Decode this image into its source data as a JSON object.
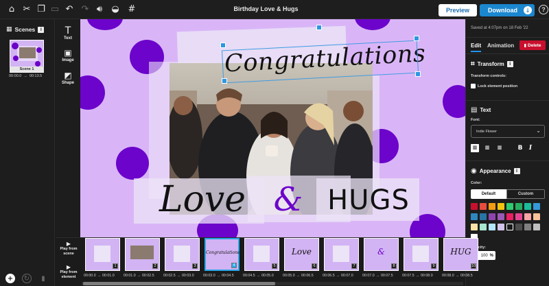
{
  "app": {
    "title": "Birthday Love & Hugs"
  },
  "toolbar": {
    "icons": [
      "home-icon",
      "scissors-icon",
      "copy-icon",
      "paste-icon",
      "undo-icon",
      "redo-icon",
      "volume-icon",
      "hide-icon",
      "grid-icon"
    ],
    "preview_label": "Preview",
    "download_label": "Download",
    "help_label": "?"
  },
  "scenes": {
    "header": "Scenes",
    "items": [
      {
        "label": "Scene 1",
        "start": "00:00.0",
        "arrow": "→",
        "end": "00:13.5"
      }
    ]
  },
  "tools": [
    {
      "label": "Text",
      "icon": "text-tool-icon"
    },
    {
      "label": "Image",
      "icon": "image-tool-icon"
    },
    {
      "label": "Shape",
      "icon": "shape-tool-icon"
    }
  ],
  "canvas": {
    "title_text": "Congratulations",
    "love_text": "Love",
    "amp_text": "&",
    "hugs_text": "HUGS",
    "background": "#d9b5f7",
    "accent": "#6c04cb"
  },
  "properties": {
    "saved_at": "Saved at 4:07pm on 18 Feb '22",
    "tabs": {
      "edit": "Edit",
      "animation": "Animation"
    },
    "delete_label": "Delete",
    "transform": {
      "title": "Transform",
      "controls_label": "Transform controls:",
      "lock_label": "Lock element position"
    },
    "text": {
      "title": "Text",
      "font_label": "Font:",
      "font_value": "Indie Flower",
      "bold": "B",
      "italic": "I"
    },
    "appearance": {
      "title": "Appearance",
      "color_label": "Color:",
      "tab_default": "Default",
      "tab_custom": "Custom",
      "opacity_label": "Opacity:",
      "opacity_value": "100",
      "opacity_unit": "%",
      "swatches": [
        "#c8102e",
        "#e74c3c",
        "#f39c12",
        "#f1c40f",
        "#2ecc71",
        "#27ae60",
        "#1abc9c",
        "#3498db",
        "#2e86c1",
        "#2874a6",
        "#8e44ad",
        "#9b59b6",
        "#e91e63",
        "#e84393",
        "#f8a5a5",
        "#fbc39b",
        "#fde3a7",
        "#a8e6cf",
        "#b3e5fc",
        "#d1c4e9",
        "#1a1a1a",
        "#4d4d4d",
        "#808080",
        "#bfbfbf",
        "#ffffff"
      ]
    }
  },
  "timeline": {
    "play_scene": "Play from scene",
    "play_element": "Play from element",
    "frames": [
      {
        "num": "1",
        "cap": "",
        "start": "00:00.0",
        "end": "00:01.0"
      },
      {
        "num": "2",
        "cap": "",
        "start": "00:01.0",
        "end": "00:02.5"
      },
      {
        "num": "3",
        "cap": "",
        "start": "00:02.5",
        "end": "00:03.0"
      },
      {
        "num": "4",
        "cap": "Congratulations",
        "start": "00:03.0",
        "end": "00:04.5"
      },
      {
        "num": "5",
        "cap": "",
        "start": "00:04.5",
        "end": "00:05.0"
      },
      {
        "num": "6",
        "cap": "Love",
        "start": "00:05.0",
        "end": "00:06.5"
      },
      {
        "num": "7",
        "cap": "",
        "start": "00:06.5",
        "end": "00:07.0"
      },
      {
        "num": "8",
        "cap": "&",
        "start": "00:07.0",
        "end": "00:07.5"
      },
      {
        "num": "9",
        "cap": "",
        "start": "00:07.5",
        "end": "00:08.0"
      },
      {
        "num": "10",
        "cap": "HUG",
        "start": "00:08.0",
        "end": "00:08.5"
      }
    ]
  }
}
